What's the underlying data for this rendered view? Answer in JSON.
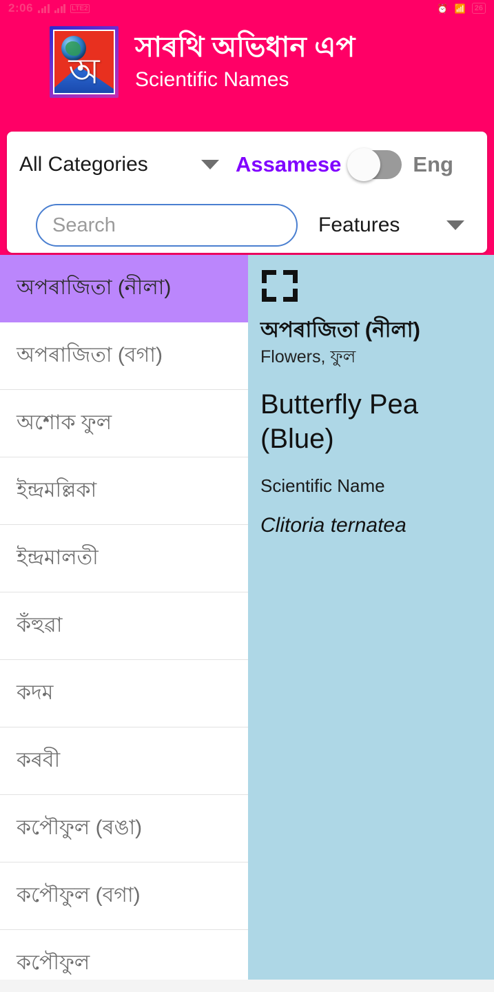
{
  "status_bar": {
    "time": "2:06",
    "network_label": "LTE2",
    "battery": "26",
    "bluetooth_icon": "bluetooth-icon",
    "alarm_icon": "alarm-icon",
    "signal_icon": "signal-bars-icon"
  },
  "header": {
    "title": "সাৰথি অভিধান এপ",
    "subtitle": "Scientific Names",
    "logo_char": "অ",
    "background_color": "#ff0066"
  },
  "controls": {
    "category_dropdown": "All Categories",
    "language_left": "Assamese",
    "language_right": "Eng",
    "language_toggle_state": "off",
    "search_placeholder": "Search",
    "search_value": "",
    "features_dropdown": "Features",
    "accent_purple": "#8000ff"
  },
  "list": {
    "selected_index": 0,
    "items": [
      {
        "label": "অপৰাজিতা (নীলা)"
      },
      {
        "label": "অপৰাজিতা (বগা)"
      },
      {
        "label": "অশোক ফুল"
      },
      {
        "label": "ইন্দ্ৰমল্লিকা"
      },
      {
        "label": "ইন্দ্ৰমালতী"
      },
      {
        "label": "কঁহুৱা"
      },
      {
        "label": "কদম"
      },
      {
        "label": "কৰবী"
      },
      {
        "label": "কপৌফুল (ৰঙা)"
      },
      {
        "label": "কপৌফুল (বগা)"
      },
      {
        "label": "কপৌফুল"
      }
    ],
    "selected_color": "#bb86fc"
  },
  "detail": {
    "expand_icon": "fullscreen-expand-icon",
    "title": "অপৰাজিতা (নীলা)",
    "category": "Flowers, ফুল",
    "english_name": "Butterfly Pea (Blue)",
    "scientific_label": "Scientific Name",
    "scientific_name": "Clitoria ternatea",
    "background_color": "#aed7e6"
  }
}
